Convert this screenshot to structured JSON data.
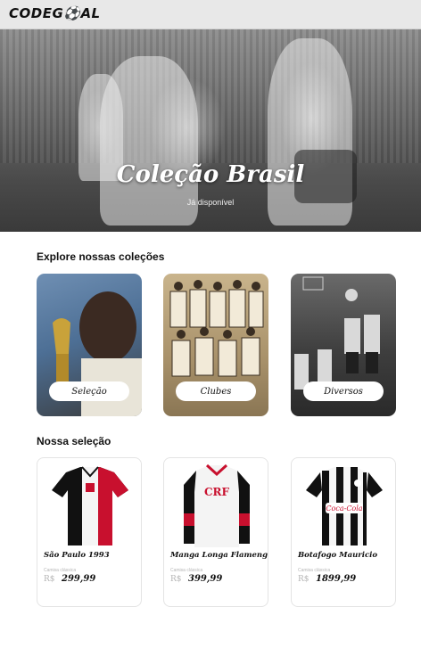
{
  "header": {
    "logo": "CODEG⚽AL"
  },
  "hero": {
    "title": "Coleção Brasil",
    "subtitle": "Já disponível"
  },
  "collections": {
    "title": "Explore nossas coleções",
    "items": [
      {
        "label": "Seleção"
      },
      {
        "label": "Clubes"
      },
      {
        "label": "Diversos"
      }
    ]
  },
  "selection": {
    "title": "Nossa seleção",
    "products": [
      {
        "name": "São Paulo 1993",
        "note": "Camisa clássica",
        "currency": "R$",
        "price": "299,99"
      },
      {
        "name": "Manga Longa Flamengo",
        "note": "Camisa clássica",
        "currency": "R$",
        "price": "399,99"
      },
      {
        "name": "Botafogo Mauricio",
        "note": "Camisa clássica",
        "currency": "R$",
        "price": "1899,99"
      }
    ]
  }
}
